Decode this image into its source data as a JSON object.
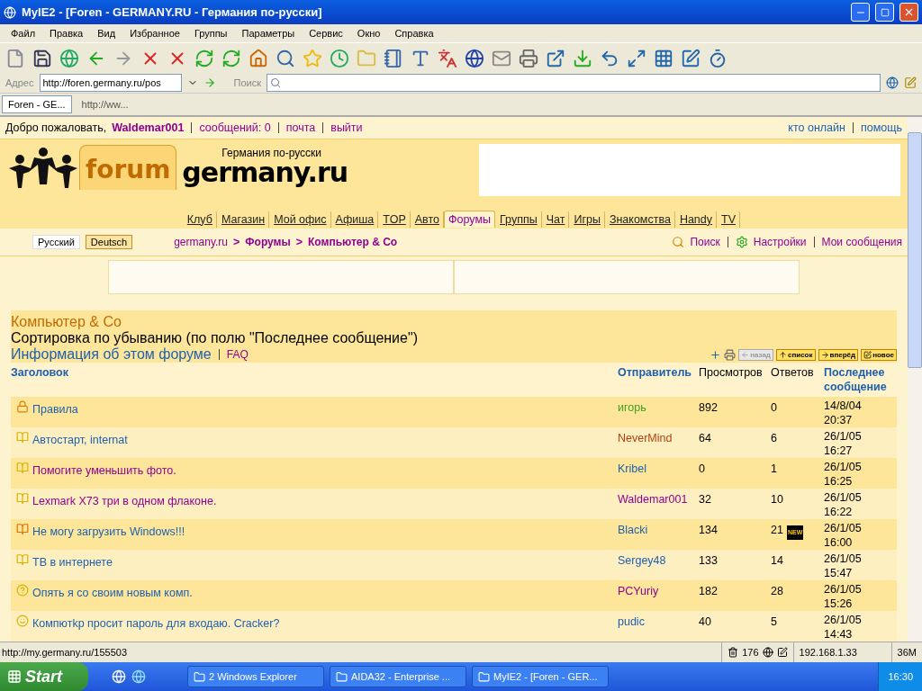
{
  "window": {
    "title": "MyIE2 - [Foren - GERMANY.RU - Германия по-русски]"
  },
  "menu": [
    "Файл",
    "Правка",
    "Вид",
    "Избранное",
    "Группы",
    "Параметры",
    "Сервис",
    "Окно",
    "Справка"
  ],
  "address": {
    "label": "Адрес",
    "url": "http://foren.germany.ru/pos",
    "search_label": "Поиск"
  },
  "tabs": [
    {
      "label": "Foren - GE...",
      "selected": true
    },
    {
      "label": "http://ww...",
      "selected": false
    }
  ],
  "page": {
    "welcome": {
      "text": "Добро пожаловать,",
      "user": "Waldemar001",
      "links": [
        "сообщений: 0",
        "почта",
        "выйти"
      ],
      "right_links": [
        "кто онлайн",
        "помощь"
      ]
    },
    "logo": {
      "word": "forum",
      "tagline": "Германия по-русски",
      "domain": "germany.ru"
    },
    "nav": [
      {
        "label": "Клуб",
        "selected": false
      },
      {
        "label": "Магазин",
        "selected": false
      },
      {
        "label": "Мой офис",
        "selected": false
      },
      {
        "label": "Афиша",
        "selected": false
      },
      {
        "label": "TOP",
        "selected": false
      },
      {
        "label": "Авто",
        "selected": false
      },
      {
        "label": "Форумы",
        "selected": true
      },
      {
        "label": "Группы",
        "selected": false
      },
      {
        "label": "Чат",
        "selected": false
      },
      {
        "label": "Игры",
        "selected": false
      },
      {
        "label": "Знакомства",
        "selected": false
      },
      {
        "label": "Handy",
        "selected": false
      },
      {
        "label": "TV",
        "selected": false
      }
    ],
    "languages": [
      {
        "label": "Русский",
        "selected": false
      },
      {
        "label": "Deutsch",
        "selected": true
      }
    ],
    "breadcrumb": [
      {
        "label": "germany.ru"
      },
      {
        "separator": ">",
        "label": "Форумы"
      },
      {
        "separator": ">",
        "label": "Компьютер & Co"
      }
    ],
    "tools": [
      "Поиск",
      "Настройки",
      "Мои сообщения"
    ],
    "forum": {
      "title": "Компьютер & Co",
      "sort": "Сортировка по убыванию (по полю \"Последнее сообщение\")",
      "info_link": "Информация об этом форуме",
      "faq": "FAQ",
      "actions": [
        {
          "label": "назад",
          "disabled": true
        },
        {
          "label": "список",
          "disabled": false
        },
        {
          "label": "вперёд",
          "disabled": false
        },
        {
          "label": "новое",
          "disabled": false
        }
      ],
      "columns": [
        "Заголовок",
        "Отправитель",
        "Просмотров",
        "Ответов",
        "Последнее сообщение"
      ],
      "rows": [
        {
          "kind": "lock",
          "topic": {
            "text": "Правила",
            "color": "#2060b0"
          },
          "author": {
            "text": "игорь",
            "color": "#40a020"
          },
          "views": "892",
          "replies": "0",
          "date": "14/8/04",
          "time": "20:37"
        },
        {
          "kind": "book",
          "topic": {
            "text": "Автостарт, internat",
            "color": "#2060b0"
          },
          "author": {
            "text": "NeverMind",
            "color": "#b04010"
          },
          "views": "64",
          "replies": "6",
          "date": "26/1/05",
          "time": "16:27"
        },
        {
          "kind": "book",
          "topic": {
            "text": "Помогите уменьшить фото.",
            "color": "#900090"
          },
          "author": {
            "text": "Kribel",
            "color": "#2060b0"
          },
          "views": "0",
          "replies": "1",
          "date": "26/1/05",
          "time": "16:25"
        },
        {
          "kind": "book",
          "topic": {
            "text": "Lexmark X73 три в одном флаконе.",
            "color": "#900090"
          },
          "author": {
            "text": "Waldemar001",
            "color": "#900090"
          },
          "views": "32",
          "replies": "10",
          "date": "26/1/05",
          "time": "16:22"
        },
        {
          "kind": "hot",
          "topic": {
            "text": "Не могу загрузить Windows!!!",
            "color": "#2060b0"
          },
          "author": {
            "text": "Blacki",
            "color": "#2060b0"
          },
          "views": "134",
          "replies": "21",
          "badge": "NEW",
          "date": "26/1/05",
          "time": "16:00"
        },
        {
          "kind": "book",
          "topic": {
            "text": "ТВ в интернете",
            "color": "#2060b0"
          },
          "author": {
            "text": "Sergey48",
            "color": "#2060b0"
          },
          "views": "133",
          "replies": "14",
          "date": "26/1/05",
          "time": "15:47"
        },
        {
          "kind": "question",
          "topic": {
            "text": "Опять я со своим новым комп.",
            "color": "#2060b0"
          },
          "author": {
            "text": "PCYuriy",
            "color": "#900090"
          },
          "views": "182",
          "replies": "28",
          "date": "26/1/05",
          "time": "15:26"
        },
        {
          "kind": "smiley",
          "topic": {
            "text": "Компютkр просит пароль для входаю. Cracker?",
            "color": "#2060b0"
          },
          "author": {
            "text": "pudic",
            "color": "#2060b0"
          },
          "views": "40",
          "replies": "5",
          "date": "26/1/05",
          "time": "14:43"
        }
      ]
    }
  },
  "status_bar": {
    "url": "http://my.germany.ru/155503",
    "count": "176",
    "ip": "192.168.1.33",
    "memory": "36M"
  },
  "taskbar": {
    "start": "Start",
    "items": [
      "2 Windows Explorer",
      "AIDA32 - Enterprise ...",
      "MyIE2 - [Foren - GER..."
    ],
    "clock": "16:30"
  }
}
